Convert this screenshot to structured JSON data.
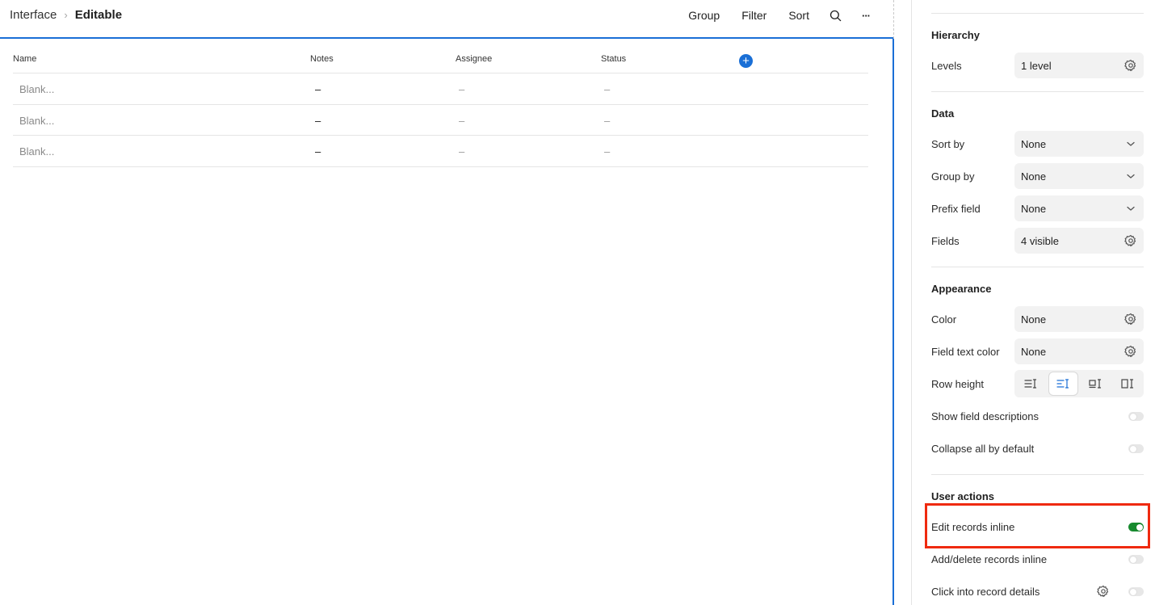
{
  "breadcrumb": {
    "parent": "Interface",
    "separator": "›",
    "current": "Editable"
  },
  "toolbar": {
    "group": "Group",
    "filter": "Filter",
    "sort": "Sort",
    "search_icon": "search-icon",
    "more": "···"
  },
  "table": {
    "columns": [
      "Name",
      "Notes",
      "Assignee",
      "Status"
    ],
    "add_column_label": "+",
    "rows": [
      {
        "name": "Blank...",
        "notes": "–",
        "assignee": "–",
        "status": "–"
      },
      {
        "name": "Blank...",
        "notes": "–",
        "assignee": "–",
        "status": "–"
      },
      {
        "name": "Blank...",
        "notes": "–",
        "assignee": "–",
        "status": "–"
      }
    ]
  },
  "panel": {
    "hierarchy": {
      "title": "Hierarchy",
      "levels_label": "Levels",
      "levels_value": "1 level"
    },
    "data": {
      "title": "Data",
      "sort_by_label": "Sort by",
      "sort_by_value": "None",
      "group_by_label": "Group by",
      "group_by_value": "None",
      "prefix_label": "Prefix field",
      "prefix_value": "None",
      "fields_label": "Fields",
      "fields_value": "4 visible"
    },
    "appearance": {
      "title": "Appearance",
      "color_label": "Color",
      "color_value": "None",
      "field_text_color_label": "Field text color",
      "field_text_color_value": "None",
      "row_height_label": "Row height",
      "row_height_selected": 2,
      "show_field_descriptions_label": "Show field descriptions",
      "show_field_descriptions_on": false,
      "collapse_all_label": "Collapse all by default",
      "collapse_all_on": false
    },
    "user_actions": {
      "title": "User actions",
      "edit_inline_label": "Edit records inline",
      "edit_inline_on": true,
      "add_delete_label": "Add/delete records inline",
      "add_delete_on": false,
      "click_into_label": "Click into record details",
      "click_into_on": false
    }
  },
  "colors": {
    "accent": "#1a6fd6",
    "toggle_on": "#178a2e",
    "highlight": "#ef2a0f"
  }
}
